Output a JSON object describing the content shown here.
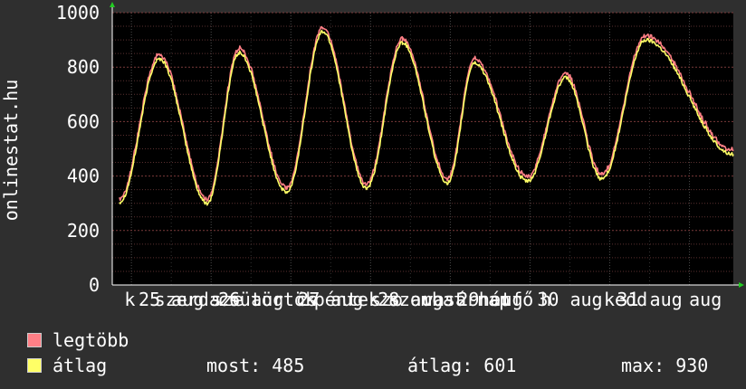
{
  "chart_data": {
    "type": "line",
    "ylabel": "onlinestat.hu",
    "ylim": [
      0,
      1000
    ],
    "yticks": [
      "0",
      "200",
      "400",
      "600",
      "800",
      "1000"
    ],
    "grid": true,
    "xlim": [
      -0.24,
      7.55
    ],
    "x_labels": [
      {
        "x": -0.02,
        "text": "k"
      },
      {
        "x": 0.7,
        "text": "szerda"
      },
      {
        "x": 1.2,
        "text": "sze"
      },
      {
        "x": 1.7,
        "text": "csütörtök"
      },
      {
        "x": 2.2,
        "text": "cs"
      },
      {
        "x": 2.7,
        "text": "péntek"
      },
      {
        "x": 3.2,
        "text": "szo"
      },
      {
        "x": 3.7,
        "text": "szombat"
      },
      {
        "x": 4.2,
        "text": "vasárnap"
      },
      {
        "x": 4.7,
        "text": "hétfő"
      },
      {
        "x": 5.2,
        "text": "h"
      },
      {
        "x": 6.2,
        "text": "kedd"
      },
      {
        "x": 7.2,
        "text": "aug"
      }
    ],
    "x_date_labels": [
      {
        "x": 0.5,
        "text": "25 aug"
      },
      {
        "x": 1.5,
        "text": "26 aug"
      },
      {
        "x": 2.5,
        "text": "27 aug"
      },
      {
        "x": 3.5,
        "text": "28 aug"
      },
      {
        "x": 4.5,
        "text": "29 aug"
      },
      {
        "x": 5.5,
        "text": "30 aug"
      },
      {
        "x": 6.5,
        "text": "31 aug"
      }
    ],
    "valleys": [
      {
        "x": -0.15,
        "y": 305
      },
      {
        "x": 0.95,
        "y": 300
      },
      {
        "x": 1.95,
        "y": 340
      },
      {
        "x": 2.95,
        "y": 355
      },
      {
        "x": 3.97,
        "y": 375
      },
      {
        "x": 4.97,
        "y": 380
      },
      {
        "x": 5.9,
        "y": 390
      },
      {
        "x": 7.55,
        "y": 480
      }
    ],
    "peaks": [
      {
        "x": 0.35,
        "y": 830
      },
      {
        "x": 1.35,
        "y": 852
      },
      {
        "x": 2.4,
        "y": 930
      },
      {
        "x": 3.4,
        "y": 890
      },
      {
        "x": 4.3,
        "y": 815
      },
      {
        "x": 5.45,
        "y": 760
      },
      {
        "x": 6.45,
        "y": 900
      }
    ],
    "series": [
      {
        "name": "legtöbb",
        "color": "#ff7f86",
        "offset": 12
      },
      {
        "name": "átlag",
        "color": "#ffff66",
        "offset": 0
      }
    ]
  },
  "legend": {
    "max_label": "legtöbb",
    "avg_label": "átlag",
    "stats": [
      {
        "label": "most:",
        "value": "485"
      },
      {
        "label": "átlag:",
        "value": "601"
      },
      {
        "label": "max:",
        "value": "930"
      }
    ]
  }
}
